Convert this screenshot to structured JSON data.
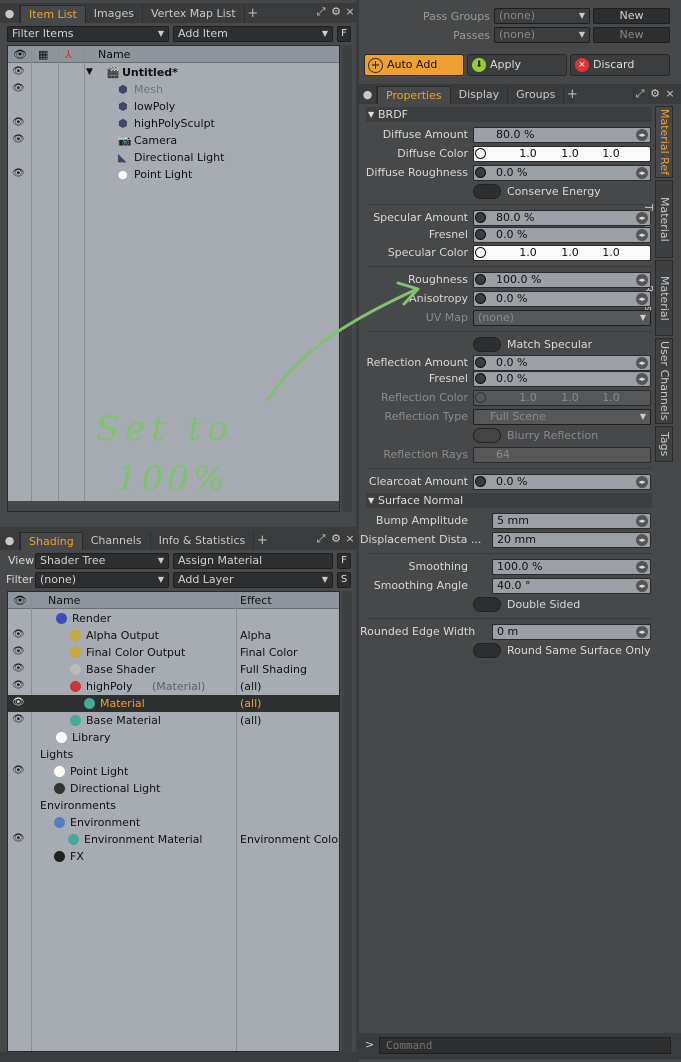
{
  "item_panel": {
    "tabs": [
      "Item List",
      "Images",
      "Vertex Map List"
    ],
    "filter": "Filter Items",
    "add_item": "Add Item",
    "f": "F",
    "name_col": "Name",
    "rows": [
      {
        "label": "Untitled*",
        "eye": true,
        "bold": true
      },
      {
        "label": "Mesh",
        "eye": true,
        "dim": true
      },
      {
        "label": "lowPoly",
        "eye": false
      },
      {
        "label": "highPolySculpt",
        "eye": true
      },
      {
        "label": "Camera",
        "eye": true
      },
      {
        "label": "Directional Light",
        "eye": false
      },
      {
        "label": "Point Light",
        "eye": true
      }
    ]
  },
  "shading_panel": {
    "tabs": [
      "Shading",
      "Channels",
      "Info & Statistics"
    ],
    "view_label": "View",
    "view_value": "Shader Tree",
    "assign_material": "Assign Material",
    "filter_label": "Filter",
    "filter_value": "(none)",
    "add_layer": "Add Layer",
    "f": "F",
    "s": "S",
    "col_name": "Name",
    "col_effect": "Effect",
    "rows": [
      {
        "label": "Render",
        "effect": "",
        "eye": false
      },
      {
        "label": "Alpha Output",
        "effect": "Alpha",
        "eye": true
      },
      {
        "label": "Final Color Output",
        "effect": "Final Color",
        "eye": true
      },
      {
        "label": "Base Shader",
        "effect": "Full Shading",
        "eye": true
      },
      {
        "label": "highPoly",
        "suffix": "(Material)",
        "effect": "(all)",
        "eye": true
      },
      {
        "label": "Material",
        "effect": "(all)",
        "eye": true,
        "selected": true
      },
      {
        "label": "Base Material",
        "effect": "(all)",
        "eye": true
      },
      {
        "label": "Library",
        "effect": "",
        "eye": false
      },
      {
        "label": "Lights",
        "effect": "",
        "eye": false
      },
      {
        "label": "Point Light",
        "effect": "",
        "eye": true
      },
      {
        "label": "Directional Light",
        "effect": "",
        "eye": false
      },
      {
        "label": "Environments",
        "effect": "",
        "eye": false
      },
      {
        "label": "Environment",
        "effect": "",
        "eye": false
      },
      {
        "label": "Environment Material",
        "effect": "Environment Color",
        "eye": true
      },
      {
        "label": "FX",
        "effect": "",
        "eye": false
      }
    ]
  },
  "pass": {
    "groups_label": "Pass Groups",
    "groups_value": "(none)",
    "new_label": "New",
    "passes_label": "Passes",
    "passes_value": "(none)",
    "new2_label": "New"
  },
  "actions": {
    "auto_add": "Auto Add",
    "apply": "Apply",
    "discard": "Discard"
  },
  "props_tabs": [
    "Properties",
    "Display",
    "Groups"
  ],
  "vertical_tabs": [
    "Material Ref",
    "Material Trans",
    "Material Rays",
    "User Channels",
    "Tags"
  ],
  "brdf": {
    "title": "BRDF",
    "diffuse_amount_label": "Diffuse Amount",
    "diffuse_amount": "80.0 %",
    "diffuse_color_label": "Diffuse Color",
    "diffuse_color": [
      "1.0",
      "1.0",
      "1.0"
    ],
    "diffuse_roughness_label": "Diffuse Roughness",
    "diffuse_roughness": "0.0 %",
    "conserve_energy": "Conserve Energy",
    "specular_amount_label": "Specular Amount",
    "specular_amount": "80.0 %",
    "fresnel_label": "Fresnel",
    "fresnel": "0.0 %",
    "specular_color_label": "Specular Color",
    "specular_color": [
      "1.0",
      "1.0",
      "1.0"
    ],
    "roughness_label": "Roughness",
    "roughness": "100.0 %",
    "anisotropy_label": "Anisotropy",
    "anisotropy": "0.0 %",
    "uvmap_label": "UV Map",
    "uvmap": "(none)",
    "match_specular": "Match Specular",
    "reflection_amount_label": "Reflection Amount",
    "reflection_amount": "0.0 %",
    "fresnel2_label": "Fresnel",
    "fresnel2": "0.0 %",
    "reflection_color_label": "Reflection Color",
    "reflection_color": [
      "1.0",
      "1.0",
      "1.0"
    ],
    "reflection_type_label": "Reflection Type",
    "reflection_type": "Full Scene",
    "blurry_reflection": "Blurry Reflection",
    "reflection_rays_label": "Reflection Rays",
    "reflection_rays": "64",
    "clearcoat_label": "Clearcoat Amount",
    "clearcoat": "0.0 %"
  },
  "surface": {
    "title": "Surface Normal",
    "bump_label": "Bump Amplitude",
    "bump": "5 mm",
    "disp_label": "Displacement Dista ...",
    "disp": "20 mm",
    "smoothing_label": "Smoothing",
    "smoothing": "100.0 %",
    "smoothing_angle_label": "Smoothing Angle",
    "smoothing_angle": "40.0 °",
    "double_sided": "Double Sided",
    "rounded_label": "Rounded Edge Width",
    "rounded": "0 m",
    "round_same": "Round Same Surface Only"
  },
  "annotation": {
    "line1": "Set to",
    "line2": "100%"
  },
  "command_placeholder": "Command",
  "accent": "#f0a030"
}
